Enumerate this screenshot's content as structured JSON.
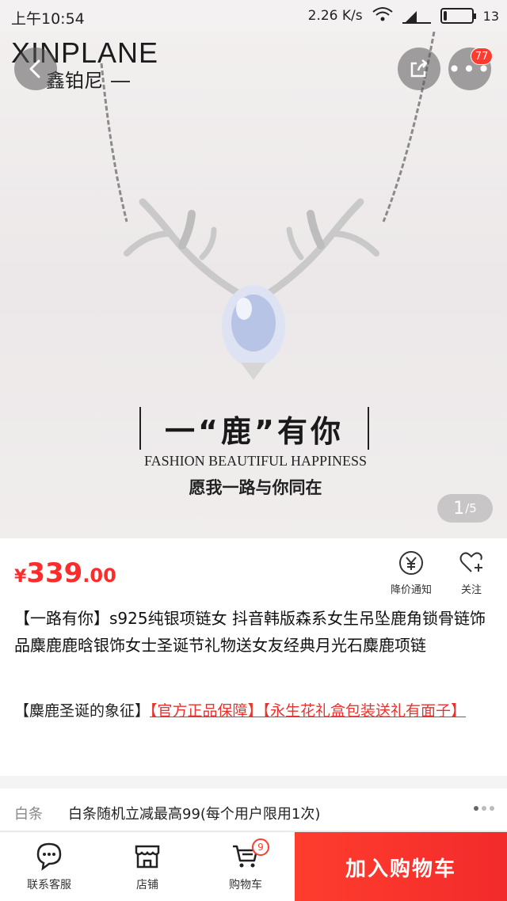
{
  "status_bar": {
    "time": "上午10:54",
    "speed": "2.26 K/s",
    "battery": "13",
    "battery_level": 0.13
  },
  "hero": {
    "brand_en": "XINPLANE",
    "brand_cn": "鑫铂尼",
    "slogan": "一“鹿”有你",
    "fashion": "FASHION BEAUTIFUL HAPPINESS",
    "wish": "愿我一路与你同在",
    "page_current": "1",
    "page_total": "/5",
    "more_badge": "77",
    "icons": {
      "back": "back-arrow-icon",
      "share": "share-icon",
      "more": "more-icon"
    }
  },
  "price": {
    "currency": "¥",
    "integer": "339",
    "decimal": ".00",
    "price_alert_label": "降价通知",
    "follow_label": "关注",
    "accent_color": "#ff2a2a"
  },
  "product": {
    "title": "【一路有你】s925纯银项链女 抖音韩版森系女生吊坠鹿角锁骨链饰品麋鹿鹿晗银饰女士圣诞节礼物送女友经典月光石麋鹿项链",
    "tag_plain": "【麋鹿圣诞的象征】",
    "tag_red_1": "【官方正品保障】",
    "tag_red_2": "【永生花礼盒包装送礼有面子】"
  },
  "baitiao": {
    "label": "白条",
    "text": "白条随机立减最高99(每个用户限用1次)"
  },
  "bottom_bar": {
    "service_label": "联系客服",
    "shop_label": "店铺",
    "cart_label": "购物车",
    "cart_count": "9",
    "add_to_cart": "加入购物车",
    "button_color": "#f22b2b"
  }
}
